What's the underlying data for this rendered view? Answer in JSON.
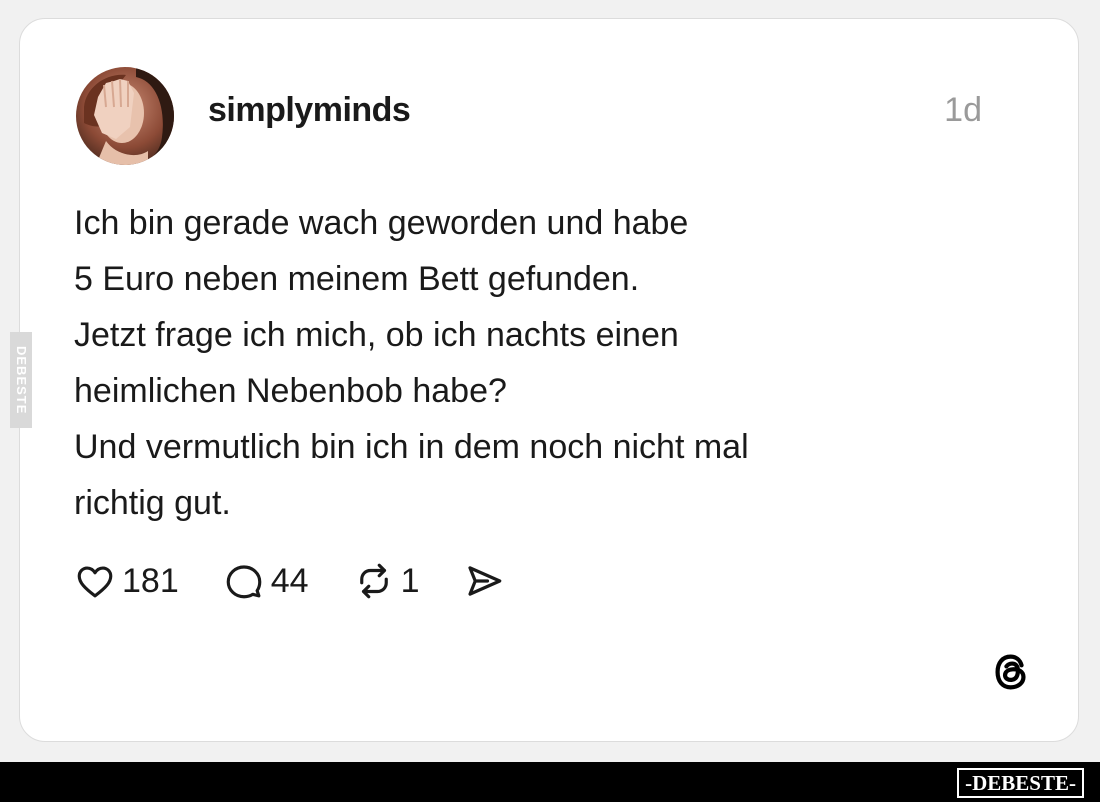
{
  "post": {
    "username": "simplyminds",
    "time_ago": "1d",
    "text_lines": [
      "Ich bin gerade wach geworden und habe",
      "5 Euro neben meinem Bett gefunden.",
      "Jetzt frage ich mich, ob ich nachts einen",
      "heimlichen Nebenbob habe?",
      "Und vermutlich bin ich in dem noch nicht mal",
      "richtig gut."
    ]
  },
  "actions": {
    "likes": {
      "icon": "heart-icon",
      "count": "181"
    },
    "replies": {
      "icon": "comment-icon",
      "count": "44"
    },
    "reposts": {
      "icon": "repost-icon",
      "count": "1"
    },
    "share": {
      "icon": "send-icon"
    }
  },
  "brand": {
    "icon": "threads-logo-icon"
  },
  "watermark": {
    "side_text": "DEBESTE",
    "footer_text": "-DEBESTE-"
  },
  "colors": {
    "text": "#1a1a1a",
    "muted": "#9a9a9a",
    "card_bg": "#ffffff",
    "footer_bg": "#000000"
  }
}
